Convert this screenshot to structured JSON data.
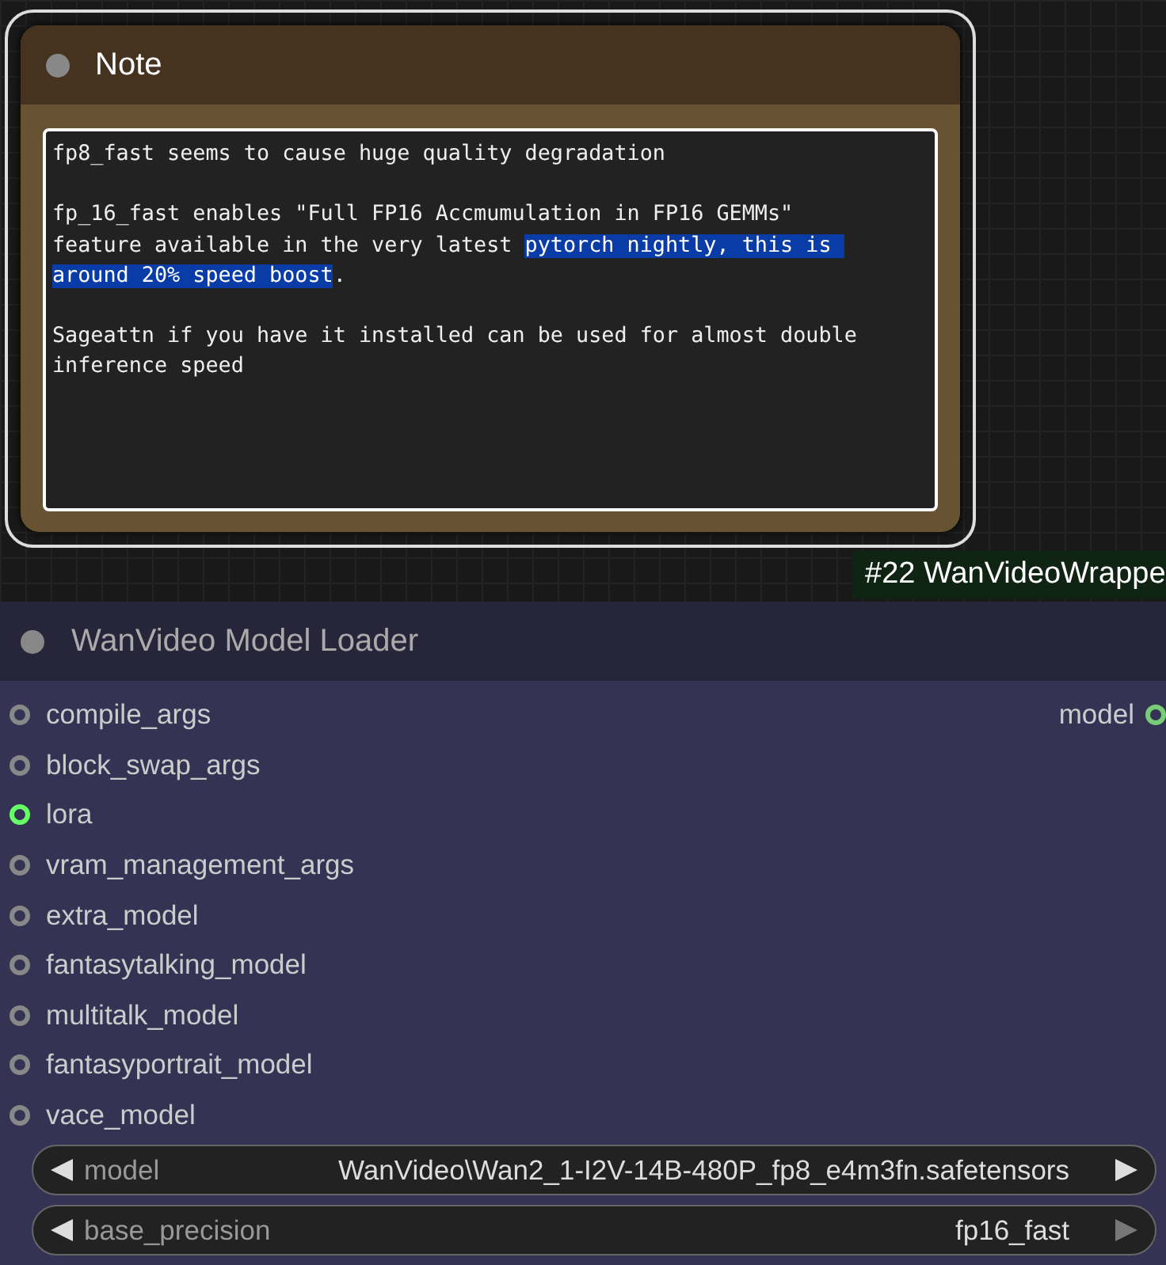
{
  "note": {
    "title": "Note",
    "selected": true,
    "paragraphs": [
      [
        [
          {
            "text": "fp8_fast seems to cause huge quality degradation",
            "selected": false
          }
        ]
      ],
      [
        [
          {
            "text": "fp_16_fast enables \"Full FP16 Accmumulation in FP16 GEMMs\"",
            "selected": false
          }
        ],
        [
          {
            "text": "feature available in the very latest ",
            "selected": false
          },
          {
            "text": "pytorch nightly, this is ",
            "selected": true
          }
        ],
        [
          {
            "text": "around 20% speed boost",
            "selected": true
          },
          {
            "text": ".",
            "selected": false
          }
        ]
      ],
      [
        [
          {
            "text": "Sageattn if you have it installed can be used for almost double",
            "selected": false
          }
        ],
        [
          {
            "text": "inference speed",
            "selected": false
          }
        ]
      ]
    ]
  },
  "badge": "#22 WanVideoWrappe",
  "loader": {
    "title": "WanVideo Model Loader",
    "inputs": [
      {
        "name": "compile_args",
        "connected": false
      },
      {
        "name": "block_swap_args",
        "connected": false
      },
      {
        "name": "lora",
        "connected": true
      },
      {
        "name": "vram_management_args",
        "connected": false
      },
      {
        "name": "extra_model",
        "connected": false
      },
      {
        "name": "fantasytalking_model",
        "connected": false
      },
      {
        "name": "multitalk_model",
        "connected": false
      },
      {
        "name": "fantasyportrait_model",
        "connected": false
      },
      {
        "name": "vace_model",
        "connected": false
      }
    ],
    "outputs": [
      {
        "name": "model",
        "connected": true
      }
    ],
    "widgets": [
      {
        "label": "model",
        "value": "WanVideo\\Wan2_1-I2V-14B-480P_fp8_e4m3fn.safetensors",
        "next_disabled": false
      },
      {
        "label": "base_precision",
        "value": "fp16_fast",
        "next_disabled": true
      }
    ]
  }
}
